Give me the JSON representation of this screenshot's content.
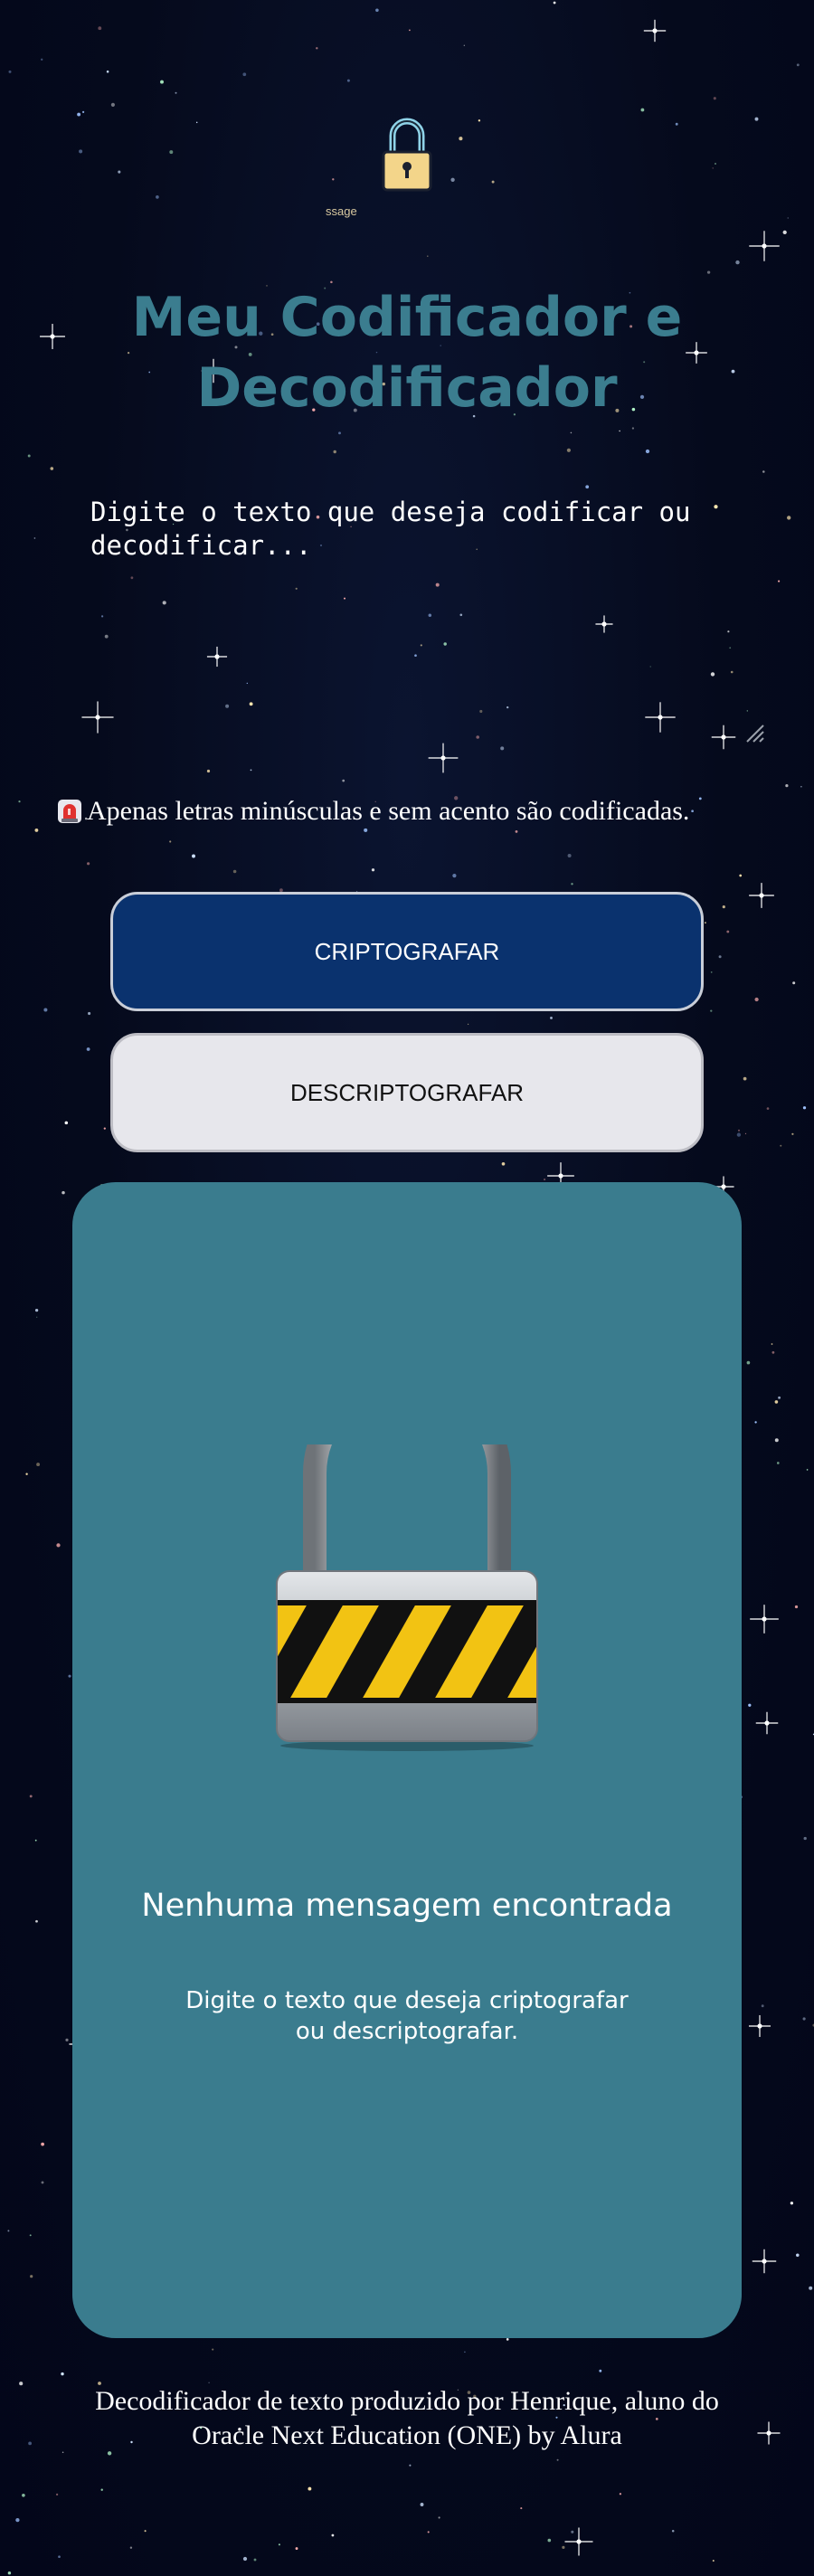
{
  "header": {
    "logo_icon": "padlock-icon",
    "logo_alt_text": "ssage",
    "title": "Meu Codificador e Decodificador"
  },
  "input": {
    "placeholder": "Digite o texto que deseja codificar ou decodificar...",
    "value": ""
  },
  "warning": {
    "icon": "alert-siren-icon",
    "text": "Apenas letras minúsculas e sem acento são codificadas."
  },
  "buttons": {
    "encrypt_label": "CRIPTOGRAFAR",
    "decrypt_label": "DESCRIPTOGRAFAR"
  },
  "result": {
    "image_icon": "padlock-caution-icon",
    "empty_title": "Nenhuma mensagem encontrada",
    "empty_text": "Digite o texto que deseja criptografar ou descriptografar."
  },
  "footer": {
    "text": "Decodificador de texto produzido por Henrique, aluno do Oracle Next Education (ONE) by Alura"
  },
  "colors": {
    "background": "#050a1c",
    "title": "#3b7d8f",
    "panel": "#3a7c8e",
    "primary_button": "#0a326e",
    "secondary_button": "#e7e7ec"
  }
}
